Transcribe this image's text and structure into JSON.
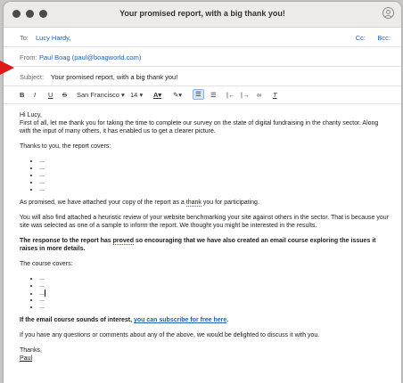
{
  "window": {
    "title": "Your promised report, with a big thank you!"
  },
  "header": {
    "to_label": "To:",
    "to_value": "Lucy Hardy,",
    "cc": "Cc:",
    "bcc": "Bcc:",
    "from_label": "From:",
    "from_value": "Paul Boag (paul@boagworld.com)",
    "subject_label": "Subject:",
    "subject_value": "Your promised report, with a big thank you!"
  },
  "toolbar": {
    "bold": "B",
    "italic": "I",
    "underline": "U",
    "strike": "S",
    "font": "San Francisco",
    "size": "14",
    "text_color": "A",
    "clear_format": "T"
  },
  "body": {
    "greeting": "Hi Lucy,",
    "para1": "First of all, let me thank you for taking the time to complete our survey on the state of digital fundraising in the charity sector. Along with the input of many others, it has enabled us to get a clearer picture.",
    "thanks_intro": "Thanks to you, the report covers:",
    "list1": [
      "...",
      "...",
      "...",
      "...",
      "..."
    ],
    "para2a": "As promised, we have attached your copy of the report as a ",
    "para2_thank": "thank",
    "para2b": " you for participating.",
    "para3": "You will also find attached a heuristic review of your website benchmarking your site against others in the sector. That is because your site was selected as one of a sample to inform the report. We thought you might be interested in the results.",
    "para4a": "The response to the report has ",
    "para4_proved": "proved",
    "para4b": " so encouraging that we have also created an email course exploring the issues it raises in more details.",
    "course_intro": "The course covers:",
    "list2": [
      "...",
      "...",
      "...",
      "...",
      "..."
    ],
    "para5a": "If the email course sounds of interest, ",
    "para5_link": "you can subscribe for free here",
    "para5b": ".",
    "para6": "If you have any questions or comments about any of the above, we would be delighted to discuss it with you.",
    "signoff": "Thanks,",
    "name": "Paul"
  },
  "colors": {
    "link": "#1f5fb8",
    "annotation_arrow": "#e0181a"
  }
}
